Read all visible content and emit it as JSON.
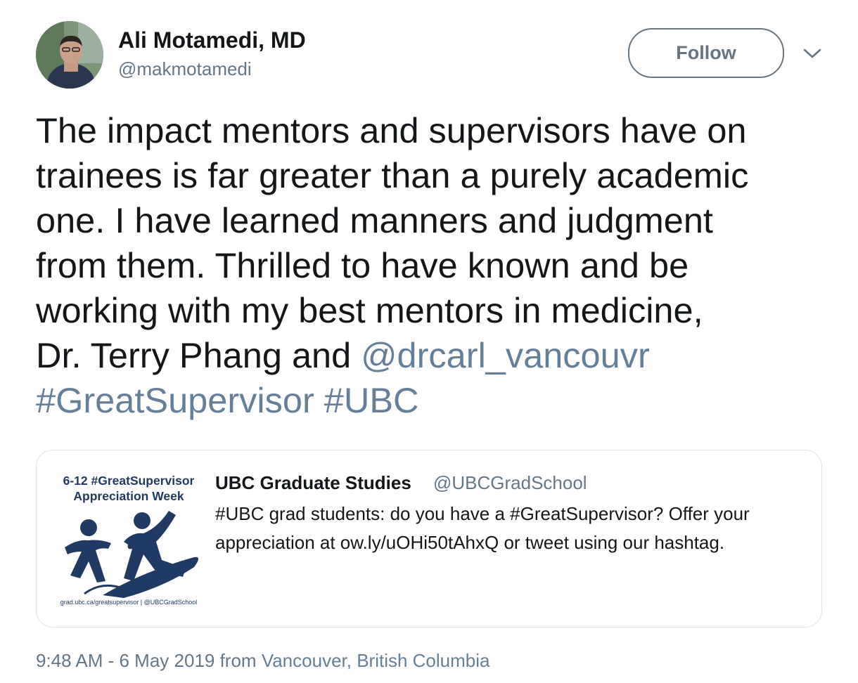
{
  "author": {
    "display_name": "Ali Motamedi, MD",
    "handle": "@makmotamedi"
  },
  "follow_label": "Follow",
  "tweet": {
    "lines": [
      "The impact mentors and supervisors have on",
      "trainees is far greater than a purely academic",
      "one. I have learned manners and judgment",
      "from them. Thrilled to have known and be",
      "working with my best mentors in medicine,"
    ],
    "line6_text": "Dr. Terry Phang and ",
    "mention": "@drcarl_vancouvr",
    "hashtag_1": "#GreatSupervisor",
    "hashtag_2": "#UBC"
  },
  "quoted_tweet": {
    "image_title_line1": "6-12 #GreatSupervisor",
    "image_title_line2": "Appreciation Week",
    "image_caption": "grad.ubc.ca/greatsupervisor | @UBCGradSchool",
    "display_name": "UBC Graduate Studies",
    "handle": "@UBCGradSchool",
    "text_line1": "#UBC grad students: do you have a #GreatSupervisor? Offer your",
    "text_line2": "appreciation at ow.ly/uOHi50tAhxQ or tweet using our hashtag."
  },
  "meta": {
    "time_date": "9:48 AM - 6 May 2019 from ",
    "location": "Vancouver, British Columbia"
  },
  "colors": {
    "link": "#657f99",
    "secondary_text": "#657786",
    "ubc_navy": "#213a63"
  },
  "icons": {
    "caret": "chevron-down-icon"
  }
}
